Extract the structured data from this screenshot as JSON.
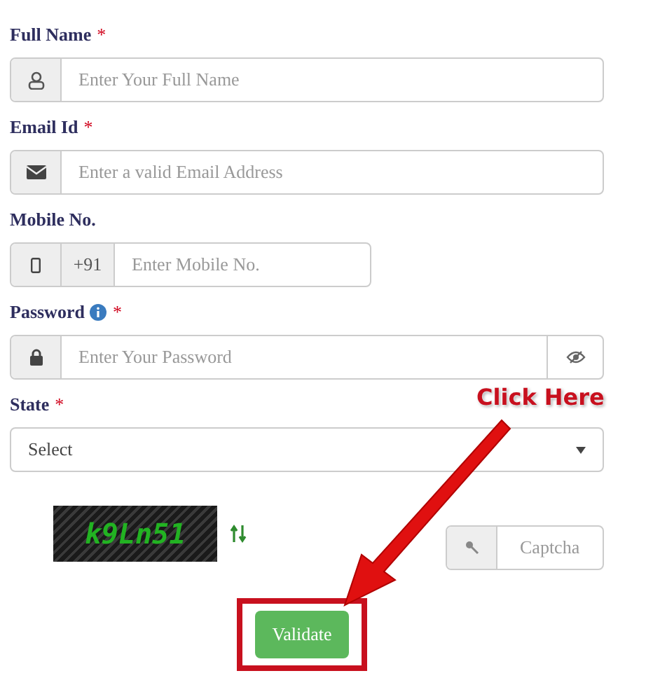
{
  "fields": [
    {
      "kind": "name",
      "label": "Full Name",
      "required_mark": "*",
      "placeholder": "Enter Your Full Name"
    },
    {
      "kind": "email",
      "label": "Email Id",
      "required_mark": "*",
      "placeholder": "Enter a valid Email Address"
    },
    {
      "kind": "mobile",
      "label": "Mobile No.",
      "prefix": "+91",
      "placeholder": "Enter Mobile No."
    },
    {
      "kind": "password",
      "label": "Password",
      "required_mark": "*",
      "placeholder": "Enter Your Password"
    },
    {
      "kind": "select",
      "label": "State",
      "required_mark": "*",
      "value": "Select"
    }
  ],
  "captcha": {
    "code": "k9Ln51",
    "placeholder": "Captcha"
  },
  "button": "Validate",
  "annotation": {
    "text": "Click Here"
  }
}
